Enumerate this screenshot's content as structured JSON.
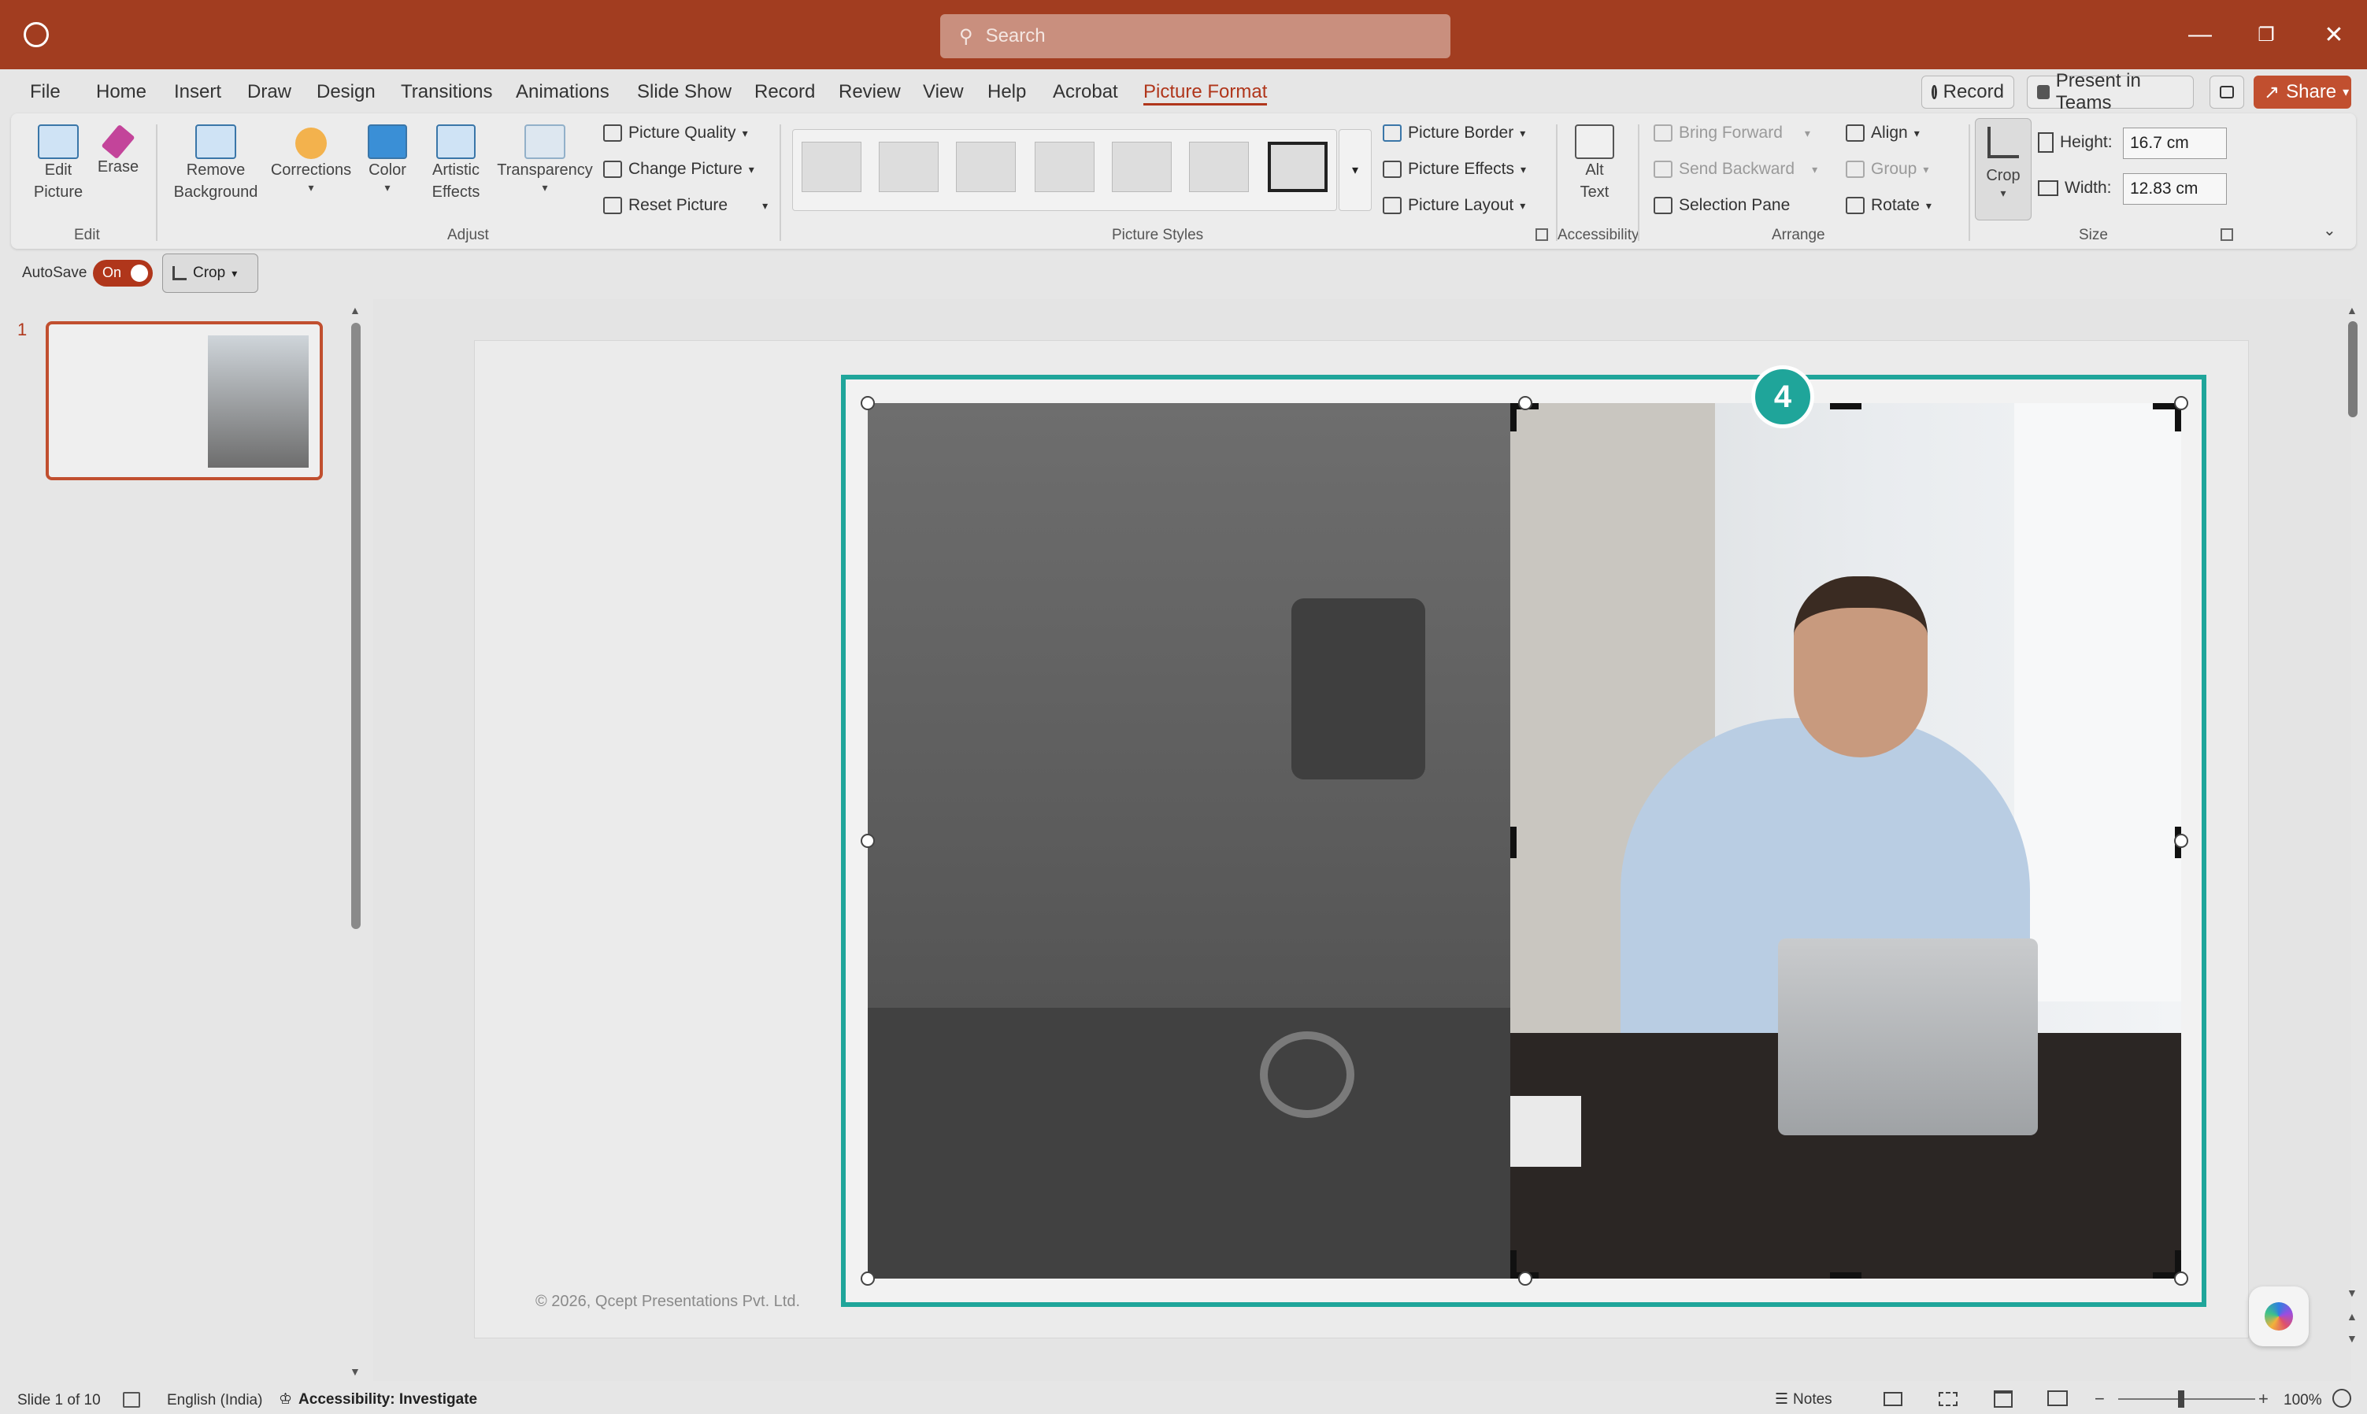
{
  "titlebar": {
    "search_placeholder": "Search",
    "bg": "#a23d20"
  },
  "menu": {
    "items": [
      "File",
      "Home",
      "Insert",
      "Draw",
      "Design",
      "Transitions",
      "Animations",
      "Slide Show",
      "Record",
      "Review",
      "View",
      "Help",
      "Acrobat",
      "Picture Format"
    ],
    "active": "Picture Format",
    "record_label": "Record",
    "present_label": "Present in Teams",
    "share_label": "Share"
  },
  "ribbon": {
    "edit": {
      "edit_picture": "Edit\nPicture",
      "erase": "Erase",
      "group": "Edit"
    },
    "adjust": {
      "remove_background": "Remove\nBackground",
      "corrections": "Corrections",
      "color": "Color",
      "artistic_effects": "Artistic\nEffects",
      "transparency": "Transparency",
      "picture_quality": "Picture Quality",
      "change_picture": "Change Picture",
      "reset_picture": "Reset Picture",
      "group": "Adjust"
    },
    "styles": {
      "group": "Picture Styles",
      "picture_border": "Picture Border",
      "picture_effects": "Picture Effects",
      "picture_layout": "Picture Layout"
    },
    "accessibility": {
      "alt_text": "Alt\nText",
      "group": "Accessibility"
    },
    "arrange": {
      "bring_forward": "Bring Forward",
      "send_backward": "Send Backward",
      "selection_pane": "Selection Pane",
      "align": "Align",
      "group_btn": "Group",
      "rotate": "Rotate",
      "group": "Arrange"
    },
    "size": {
      "crop": "Crop",
      "height_label": "Height:",
      "height_value": "16.7 cm",
      "width_label": "Width:",
      "width_value": "12.83 cm",
      "group": "Size"
    }
  },
  "qat": {
    "autosave": "AutoSave",
    "toggle": "On",
    "crop": "Crop"
  },
  "thumbnails": {
    "slide_number": "1"
  },
  "slide": {
    "footer": "© 2026, Qcept Presentations Pvt. Ltd.",
    "badge": "4",
    "selection_color": "#1fa59a"
  },
  "status": {
    "slide_info": "Slide 1 of 10",
    "language": "English (India)",
    "accessibility": "Accessibility: Investigate",
    "notes": "Notes",
    "zoom": "100%"
  }
}
